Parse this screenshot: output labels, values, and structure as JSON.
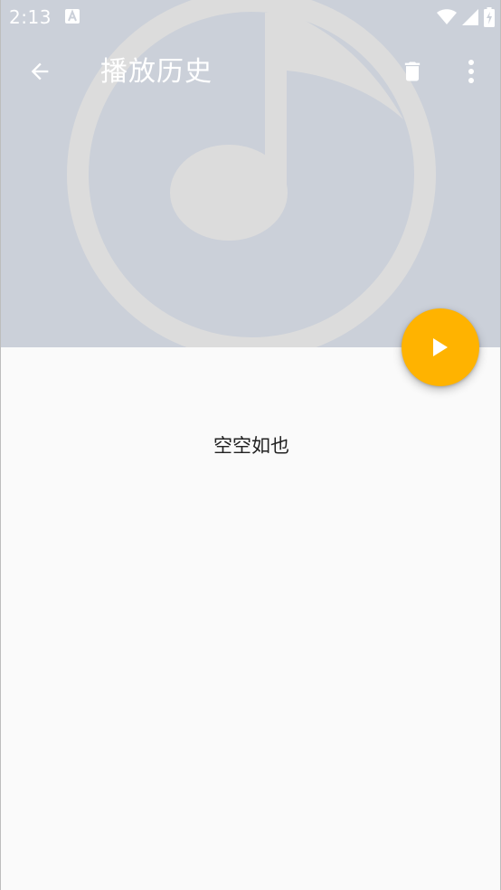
{
  "status_bar": {
    "time": "2:13",
    "icons": [
      "notification-a-icon",
      "wifi-icon",
      "signal-icon",
      "battery-charging-icon"
    ]
  },
  "toolbar": {
    "title": "播放历史",
    "back_icon": "arrow-back-icon",
    "delete_icon": "trash-icon",
    "more_icon": "more-vert-icon"
  },
  "header": {
    "background_color": "#cbd0d9",
    "art_icon": "music-note-icon"
  },
  "fab": {
    "icon": "play-icon",
    "color": "#ffb300"
  },
  "content": {
    "empty_message": "空空如也"
  }
}
